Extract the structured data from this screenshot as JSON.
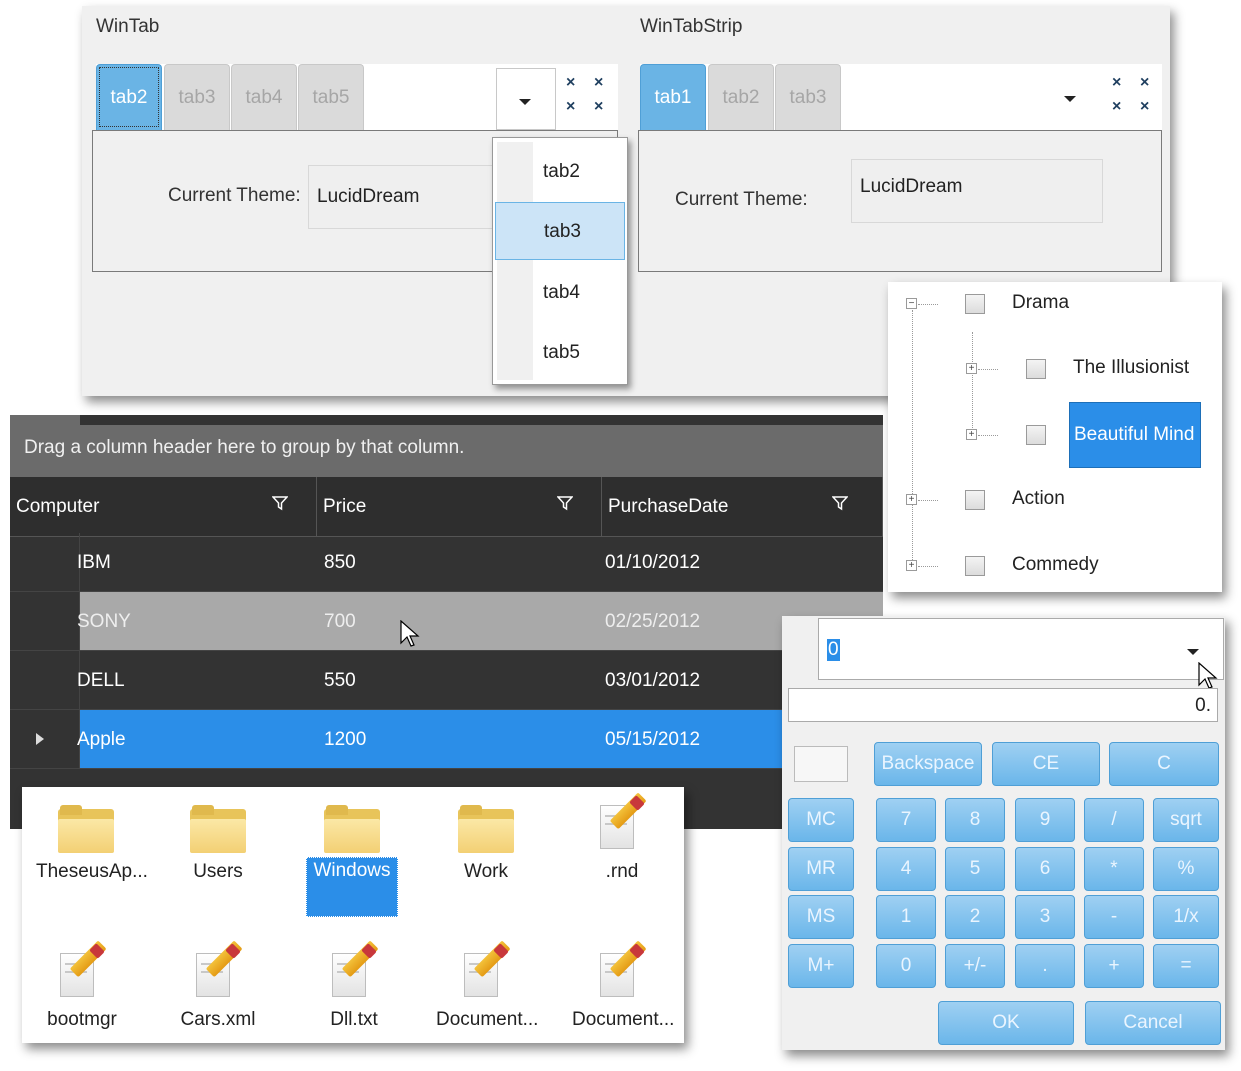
{
  "wintab": {
    "title": "WinTab",
    "tabs": [
      "tab2",
      "tab3",
      "tab4",
      "tab5"
    ],
    "theme_label": "Current Theme:",
    "theme_value": "LucidDream",
    "menu_items": [
      "tab2",
      "tab3",
      "tab4",
      "tab5"
    ],
    "close_glyph": "×"
  },
  "wintabstrip": {
    "title": "WinTabStrip",
    "tabs": [
      "tab1",
      "tab2",
      "tab3"
    ],
    "theme_label": "Current Theme:",
    "theme_value": "LucidDream"
  },
  "tree": {
    "nodes": [
      "Drama",
      "The Illusionist",
      "Beautiful Mind",
      "Action",
      "Commedy"
    ],
    "expand_glyph": "+",
    "collapse_glyph": "−"
  },
  "grid": {
    "group_hint": "Drag a column header here to group by that column.",
    "columns": [
      "Computer",
      "Price",
      "PurchaseDate"
    ],
    "rows": [
      {
        "computer": "IBM",
        "price": "850",
        "date": "01/10/2012"
      },
      {
        "computer": "SONY",
        "price": "700",
        "date": "02/25/2012"
      },
      {
        "computer": "DELL",
        "price": "550",
        "date": "03/01/2012"
      },
      {
        "computer": "Apple",
        "price": "1200",
        "date": "05/15/2012"
      }
    ]
  },
  "explorer": {
    "items": [
      "TheseusAp...",
      "Users",
      "Windows",
      "Work",
      ".rnd",
      "bootmgr",
      "Cars.xml",
      "Dll.txt",
      "Document...",
      "Document..."
    ]
  },
  "calculator": {
    "combo_value": "0",
    "display": "0.",
    "buttons": {
      "backspace": "Backspace",
      "ce": "CE",
      "c": "C",
      "mc": "MC",
      "mr": "MR",
      "ms": "MS",
      "mplus": "M+",
      "n7": "7",
      "n8": "8",
      "n9": "9",
      "div": "/",
      "sqrt": "sqrt",
      "n4": "4",
      "n5": "5",
      "n6": "6",
      "mul": "*",
      "pct": "%",
      "n1": "1",
      "n2": "2",
      "n3": "3",
      "sub": "-",
      "inv": "1/x",
      "n0": "0",
      "sign": "+/-",
      "dot": ".",
      "add": "+",
      "eq": "=",
      "ok": "OK",
      "cancel": "Cancel"
    }
  },
  "colors": {
    "accent": "#2b8ee8",
    "tab_selected": "#6ab4e5",
    "grid_bg": "#333333"
  }
}
